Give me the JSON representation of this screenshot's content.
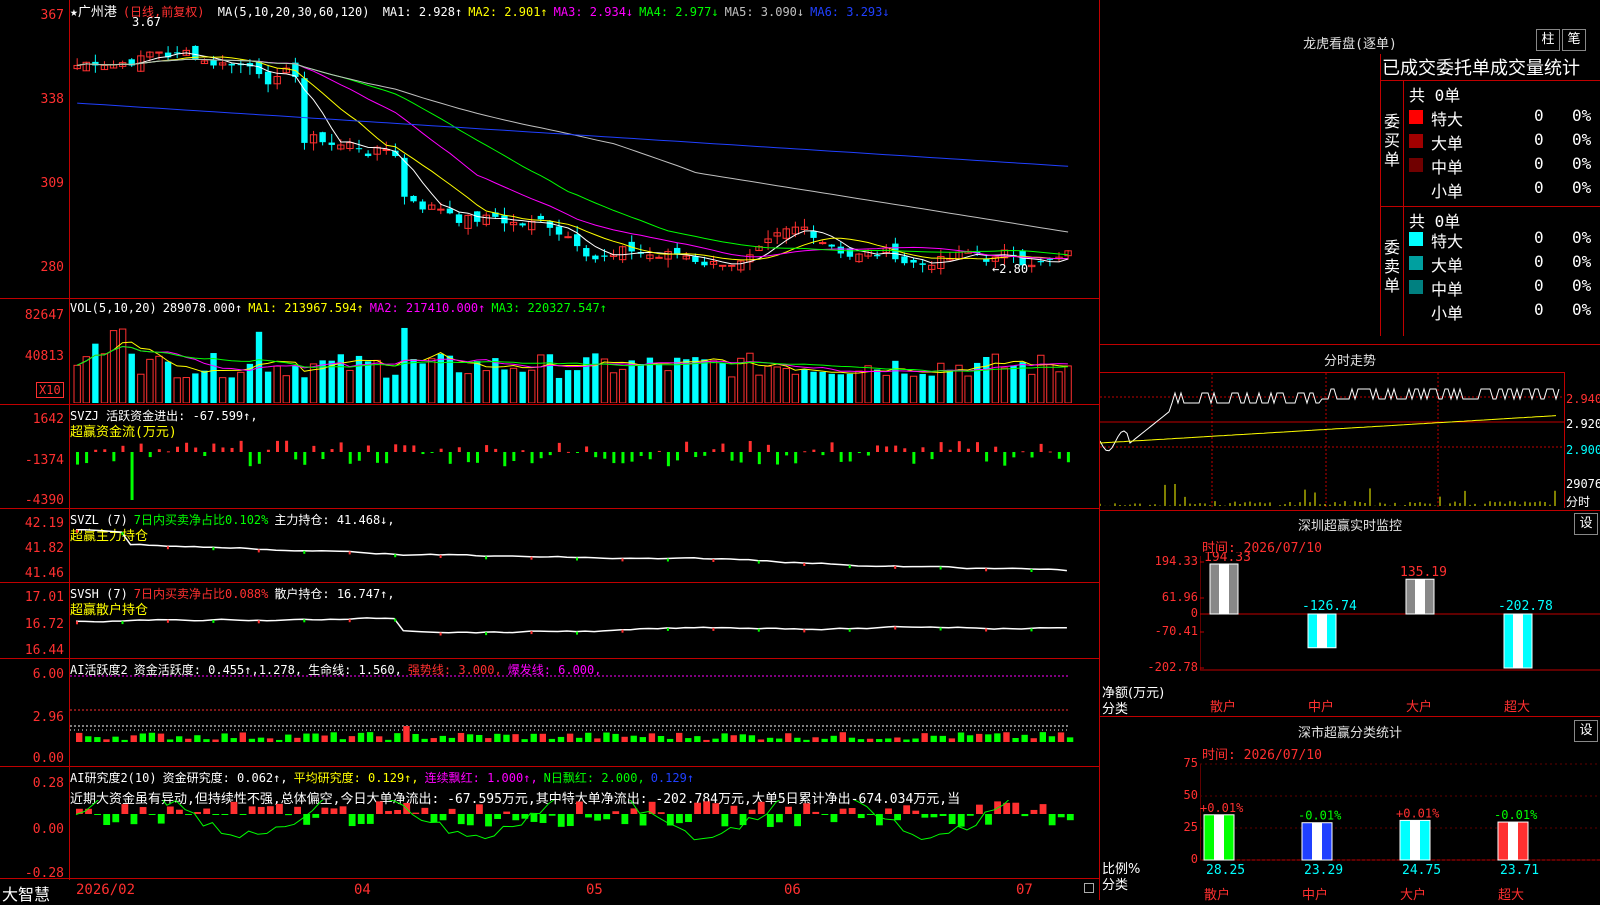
{
  "stock_title": "★广州港",
  "period": "(日线,前复权)",
  "ma_header": {
    "label": "MA(5,10,20,30,60,120)",
    "items": [
      {
        "text": "MA1: 2.928↑",
        "color": "#ffffff"
      },
      {
        "text": "MA2: 2.901↑",
        "color": "#ffff00"
      },
      {
        "text": "MA3: 2.934↓",
        "color": "#ff00ff"
      },
      {
        "text": "MA4: 2.977↓",
        "color": "#00ff00"
      },
      {
        "text": "MA5: 3.090↓",
        "color": "#c0c0c0"
      },
      {
        "text": "MA6: 3.293↓",
        "color": "#2040ff"
      }
    ]
  },
  "price_axis": [
    "367",
    "338",
    "309",
    "280"
  ],
  "price_high_label": "3.67",
  "price_low_label": "←2.80",
  "vol_header": [
    {
      "text": "VOL(5,10,20)",
      "color": "#ffffff"
    },
    {
      "text": "289078.000↑",
      "color": "#ffffff"
    },
    {
      "text": "MA1: 213967.594↑",
      "color": "#ffff00"
    },
    {
      "text": "MA2: 217410.000↑",
      "color": "#ff00ff"
    },
    {
      "text": "MA3: 220327.547↑",
      "color": "#00ff00"
    }
  ],
  "vol_axis": [
    "82647",
    "40813"
  ],
  "vol_unit": "X10",
  "svzj_header": [
    {
      "text": "SVZJ  活跃资金进出: -67.599↑,",
      "color": "#ffffff"
    }
  ],
  "svzj_sub": "超赢资金流(万元)",
  "svzj_axis": [
    "1642",
    "-1374",
    "-4390"
  ],
  "svzl_header": [
    {
      "text": "SVZL (7)",
      "color": "#ffffff"
    },
    {
      "text": "7日内买卖净占比0.102%",
      "color": "#00ff00"
    },
    {
      "text": "主力持仓: 41.468↓,",
      "color": "#ffffff"
    }
  ],
  "svzl_sub": "超赢主力持仓",
  "svzl_axis": [
    "42.19",
    "41.82",
    "41.46"
  ],
  "svsh_header": [
    {
      "text": "SVSH (7)",
      "color": "#ffffff"
    },
    {
      "text": "7日内买卖净占比0.088%",
      "color": "#ff3030"
    },
    {
      "text": "散户持仓: 16.747↑,",
      "color": "#ffffff"
    }
  ],
  "svsh_sub": "超赢散户持仓",
  "svsh_axis": [
    "17.01",
    "16.72",
    "16.44"
  ],
  "ai_act_header": [
    {
      "text": "AI活跃度2",
      "color": "#ffffff"
    },
    {
      "text": "资金活跃度: 0.455↑,1.278,",
      "color": "#ffffff"
    },
    {
      "text": "生命线: 1.560,",
      "color": "#ffffff"
    },
    {
      "text": "强势线: 3.000,",
      "color": "#ff3030"
    },
    {
      "text": "爆发线: 6.000,",
      "color": "#ff00ff"
    }
  ],
  "ai_act_axis": [
    "6.00",
    "2.96",
    "0.00"
  ],
  "ai_res_header": [
    {
      "text": "AI研究度2(10)",
      "color": "#ffffff"
    },
    {
      "text": "资金研究度: 0.062↑,",
      "color": "#ffffff"
    },
    {
      "text": "平均研究度: 0.129↑,",
      "color": "#ffff00"
    },
    {
      "text": "连续飘红: 1.000↑,",
      "color": "#ff00ff"
    },
    {
      "text": "N日飘红: 2.000,",
      "color": "#00ff00"
    },
    {
      "text": "0.129↑",
      "color": "#2040ff"
    }
  ],
  "ai_res_text": "近期大资金虽有异动,但持续性不强,总体偏空,今日大单净流出: -67.595万元,其中特大单净流出: -202.784万元,大单5日累计净出-674.034万元,当",
  "ai_res_axis": [
    "0.28",
    "0.00",
    "-0.28"
  ],
  "date_axis": [
    "2026/02",
    "04",
    "05",
    "06",
    "07"
  ],
  "bottom_brand": "大智慧",
  "dragon_title": "龙虎看盘(逐单)",
  "btn_zhu": "柱",
  "btn_bi": "笔",
  "deal_header": "已成交委托单成交量统计",
  "buy_label": "委买单",
  "sell_label": "委卖单",
  "buy_total": "共 0单",
  "sell_total": "共 0单",
  "buy_rows": [
    {
      "name": "特大",
      "count": "0",
      "pct": "0%",
      "color": "#ff0000"
    },
    {
      "name": "大单",
      "count": "0",
      "pct": "0%",
      "color": "#a00000"
    },
    {
      "name": "中单",
      "count": "0",
      "pct": "0%",
      "color": "#700000"
    },
    {
      "name": "小单",
      "count": "0",
      "pct": "0%",
      "color": "#000000"
    }
  ],
  "sell_rows": [
    {
      "name": "特大",
      "count": "0",
      "pct": "0%",
      "color": "#00ffff"
    },
    {
      "name": "大单",
      "count": "0",
      "pct": "0%",
      "color": "#00a0a0"
    },
    {
      "name": "中单",
      "count": "0",
      "pct": "0%",
      "color": "#008080"
    },
    {
      "name": "小单",
      "count": "0",
      "pct": "0%",
      "color": "#000000"
    }
  ],
  "intraday_title": "分时走势",
  "intraday_axis": [
    "2.940",
    "2.920",
    "2.900"
  ],
  "intraday_vol": "29076",
  "intraday_unit": "分时",
  "monitor_title": "深圳超赢实时监控",
  "monitor_btn": "设",
  "monitor_time": "时间: 2026/07/10",
  "monitor_axis": [
    "194.33",
    "61.96",
    "0",
    "-70.41",
    "-202.78"
  ],
  "monitor_ylabel": "净额(万元)",
  "monitor_xlabel": "分类",
  "monitor_bars": [
    {
      "cat": "散户",
      "value": 194.33,
      "label": "194.33"
    },
    {
      "cat": "中户",
      "value": -126.74,
      "label": "-126.74"
    },
    {
      "cat": "大户",
      "value": 135.19,
      "label": "135.19"
    },
    {
      "cat": "超大",
      "value": -202.78,
      "label": "-202.78"
    }
  ],
  "cls_title": "深市超赢分类统计",
  "cls_btn": "设",
  "cls_time": "时间: 2026/07/10",
  "cls_axis": [
    "75",
    "50",
    "25",
    "0"
  ],
  "cls_ylabel": "比例%",
  "cls_xlabel": "分类",
  "cls_bars": [
    {
      "cat": "散户",
      "value": 28.25,
      "change": "+0.01%",
      "label": "28.25",
      "color": "#00ff00"
    },
    {
      "cat": "中户",
      "value": 23.29,
      "change": "-0.01%",
      "label": "23.29",
      "color": "#2040ff"
    },
    {
      "cat": "大户",
      "value": 24.75,
      "change": "+0.01%",
      "label": "24.75",
      "color": "#00ffff"
    },
    {
      "cat": "超大",
      "value": 23.71,
      "change": "-0.01%",
      "label": "23.71",
      "color": "#ff3030"
    }
  ],
  "chart_data": [
    {
      "type": "bar",
      "title": "深圳超赢实时监控",
      "categories": [
        "散户",
        "中户",
        "大户",
        "超大"
      ],
      "values": [
        194.33,
        -126.74,
        135.19,
        -202.78
      ],
      "ylabel": "净额(万元)",
      "xlabel": "分类",
      "ylim": [
        -202.78,
        194.33
      ]
    },
    {
      "type": "bar",
      "title": "深市超赢分类统计",
      "categories": [
        "散户",
        "中户",
        "大户",
        "超大"
      ],
      "values": [
        28.25,
        23.29,
        24.75,
        23.71
      ],
      "ylabel": "比例%",
      "xlabel": "分类",
      "ylim": [
        0,
        75
      ]
    }
  ]
}
